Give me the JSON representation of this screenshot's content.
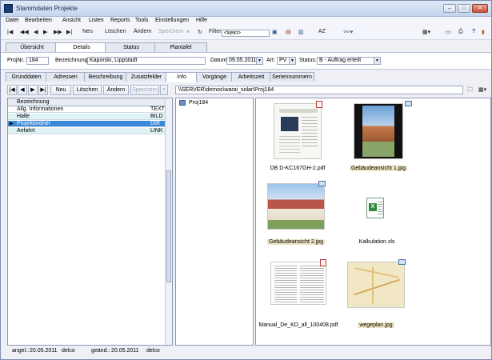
{
  "window": {
    "title": "Stammdaten Projekte"
  },
  "menu": [
    "Datei",
    "Bearbeiten",
    "Ansicht",
    "Listen",
    "Reports",
    "Tools",
    "Einstellungen",
    "Hilfe"
  ],
  "toolbar": {
    "neu": "Neu",
    "loeschen": "Löschen",
    "aendern": "Ändern",
    "speichern": "Speichern",
    "filter_label": "Filter:",
    "filter_value": "<kein>",
    "az": "AZ"
  },
  "main_tabs": [
    "Übersicht",
    "Details",
    "Status",
    "Plantafel"
  ],
  "project": {
    "projnr_label": "ProjNr.:",
    "projnr": "184",
    "bezeichnung_label": "Bezeichnung:",
    "bezeichnung": "Kaporski, Lippstadt",
    "datum_label": "Datum:",
    "datum": "09.05.2011",
    "art_label": "Art:",
    "art": "PV",
    "status_label": "Status:",
    "status": "B - Auftrag erteilt"
  },
  "sub_tabs": [
    "Grunddaten",
    "Adressen",
    "Beschreibung",
    "Zusatzfelder",
    "Info",
    "Vorgänge",
    "Arbeitszeit",
    "Seriennummern"
  ],
  "subnav": {
    "neu": "Neu",
    "loeschen": "Löschen",
    "aendern": "Ändern",
    "speichern": "Speichern"
  },
  "path": "\\\\SERVER\\demos\\warai_solar\\Proj184",
  "grid": {
    "header": "Bezeichnung",
    "rows": [
      {
        "name": "Allg. Informationen",
        "type": "TEXT"
      },
      {
        "name": "Halle",
        "type": "BILD"
      },
      {
        "name": "Projektordner",
        "type": "DIR"
      },
      {
        "name": "Anfahrt",
        "type": "LINK"
      }
    ]
  },
  "tree": {
    "root": "Proj184"
  },
  "files": [
    {
      "name": "DB D-KC167GH-2.pdf",
      "kind": "pdf"
    },
    {
      "name": "Gebäudeansicht 1.jpg",
      "kind": "jpg"
    },
    {
      "name": "Gebäudeansicht 2.jpg",
      "kind": "jpg"
    },
    {
      "name": "Kalkulation.xls",
      "kind": "xls"
    },
    {
      "name": "Manual_De_KD_all_100408.pdf",
      "kind": "pdf"
    },
    {
      "name": "wegeplan.jpg",
      "kind": "jpg"
    }
  ],
  "status": {
    "angel_label": "angel.:",
    "angel_date": "20.05.2011",
    "angel_user": "delco",
    "geaend_label": "geänd.:",
    "geaend_date": "20.05.2011",
    "geaend_user": "delco"
  },
  "colors": {
    "selection": "#3c88d8",
    "alt_row": "#dff2f4",
    "caption_highlight": "#efe6c3"
  }
}
